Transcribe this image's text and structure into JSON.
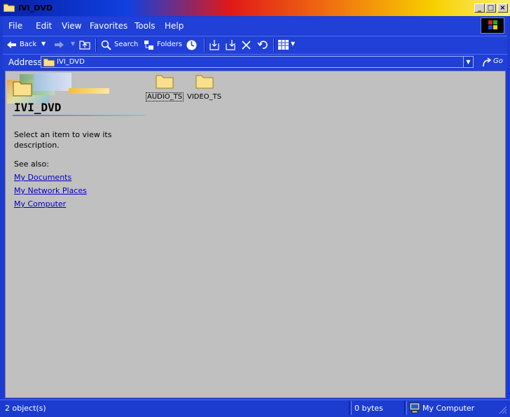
{
  "window": {
    "title": "IVI_DVD"
  },
  "menu": {
    "items": [
      {
        "label": "File"
      },
      {
        "label": "Edit"
      },
      {
        "label": "View"
      },
      {
        "label": "Favorites"
      },
      {
        "label": "Tools"
      },
      {
        "label": "Help"
      }
    ]
  },
  "toolbar": {
    "back_label": "Back",
    "search_label": "Search",
    "folders_label": "Folders"
  },
  "address": {
    "label": "Address",
    "value": "IVI_DVD",
    "go_label": "Go"
  },
  "left_pane": {
    "folder_name": "IVI_DVD",
    "description": "Select an item to view its description.",
    "see_also": "See also:",
    "links": [
      "My Documents",
      "My Network Places",
      "My Computer"
    ]
  },
  "files": [
    {
      "name": "AUDIO_TS"
    },
    {
      "name": "VIDEO_TS"
    }
  ],
  "status": {
    "objects": "2 object(s)",
    "size": "0 bytes",
    "zone": "My Computer"
  },
  "colors": {
    "chrome": "#2040d8",
    "content_bg": "#c0c0c0",
    "folder": "#f8e08c",
    "link": "#0000c0"
  }
}
